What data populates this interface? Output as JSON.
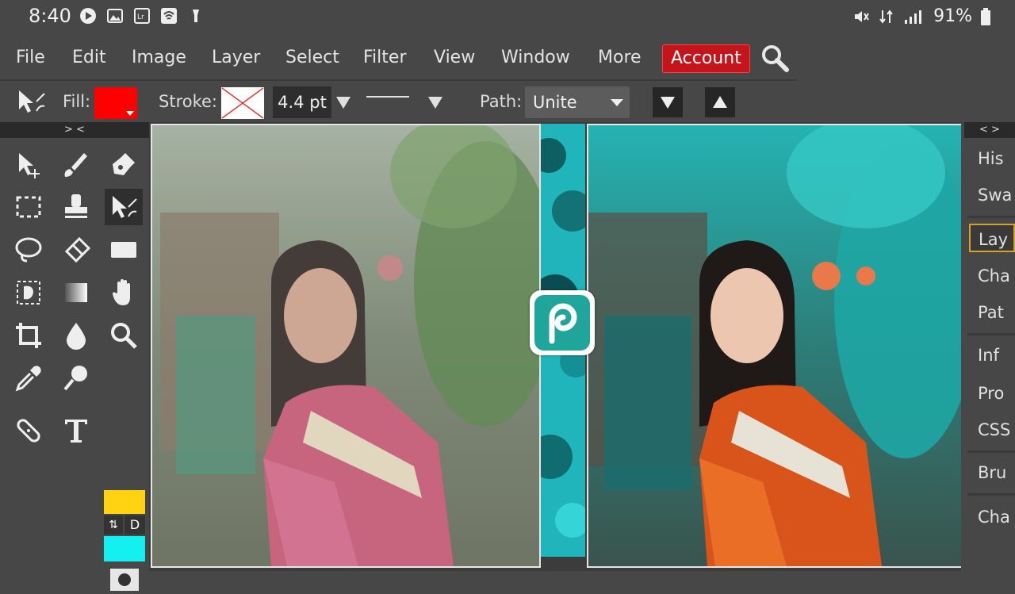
{
  "status": {
    "time": "8:40",
    "battery": "91%"
  },
  "menu": {
    "items": [
      "File",
      "Edit",
      "Image",
      "Layer",
      "Select",
      "Filter",
      "View",
      "Window",
      "More"
    ],
    "account": "Account"
  },
  "options": {
    "fill_label": "Fill:",
    "stroke_label": "Stroke:",
    "stroke_size": "4.4 pt",
    "path_label": "Path:",
    "path_value": "Unite",
    "fill_color": "#ff0000"
  },
  "left_panel": {
    "collapse_label": "> <",
    "swap_label": "⇅",
    "default_label": "D",
    "fg_color": "#ffd310",
    "bg_color": "#14f0f0"
  },
  "right_panel": {
    "collapse_label": "< >",
    "tabs": [
      "His",
      "Swa",
      "Lay",
      "Cha",
      "Pat",
      "Inf",
      "Pro",
      "CSS",
      "Bru",
      "Cha"
    ],
    "selected_tab": "Lay"
  },
  "canvas": {
    "left_image": "before (muted green-pink portrait)",
    "right_image": "after (teal-orange portrait)"
  },
  "colors": {
    "accent": "#c4151c",
    "panel": "#474747",
    "selected_tab_border": "#d2a424"
  }
}
